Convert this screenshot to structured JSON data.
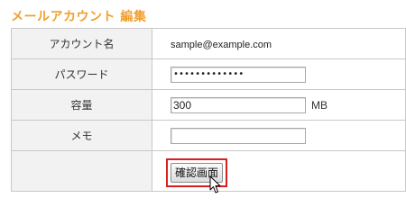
{
  "page": {
    "title": "メールアカウント 編集"
  },
  "form": {
    "account": {
      "label": "アカウント名",
      "value": "sample@example.com"
    },
    "password": {
      "label": "パスワード",
      "value": "•••••••••••••"
    },
    "quota": {
      "label": "容量",
      "value": "300",
      "unit": "MB"
    },
    "memo": {
      "label": "メモ",
      "value": ""
    },
    "confirm_button": "確認画面"
  },
  "colors": {
    "title": "#f0a030",
    "highlight_border": "#d81f1f",
    "label_bg": "#f2f2f2",
    "table_border": "#c8c8c8"
  },
  "icons": {
    "cursor": "mouse-pointer-icon"
  }
}
